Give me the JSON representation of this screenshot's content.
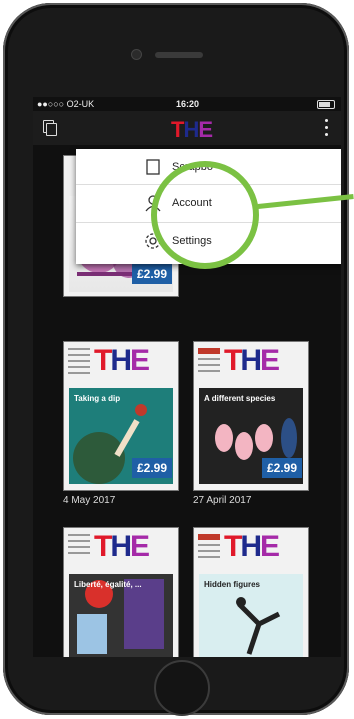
{
  "status_bar": {
    "carrier": "●●○○○ O2-UK ",
    "time": "16:20"
  },
  "app_bar": {
    "logo": "THE"
  },
  "menu": {
    "items": [
      {
        "label": "Scrapbo",
        "icon": "scrapbook-icon"
      },
      {
        "label": "Account",
        "icon": "user-icon"
      },
      {
        "label": "Settings",
        "icon": "gear-icon"
      }
    ]
  },
  "issues": [
    {
      "price": "£2.99",
      "date": "",
      "headline": ""
    },
    {
      "price": "£2.99",
      "date": "4 May 2017",
      "headline": "Taking a dip"
    },
    {
      "price": "£2.99",
      "date": "27 April 2017",
      "headline": "A different species"
    },
    {
      "price": "",
      "date": "",
      "headline": "Liberté, égalité, ..."
    },
    {
      "price": "",
      "date": "",
      "headline": "Hidden figures"
    }
  ],
  "colors": {
    "accent": "#7bc143",
    "price_bg": "#1f5fa6",
    "masthead_t": "#e0192a",
    "masthead_h": "#1e2a8c",
    "masthead_e": "#a52aa8"
  }
}
